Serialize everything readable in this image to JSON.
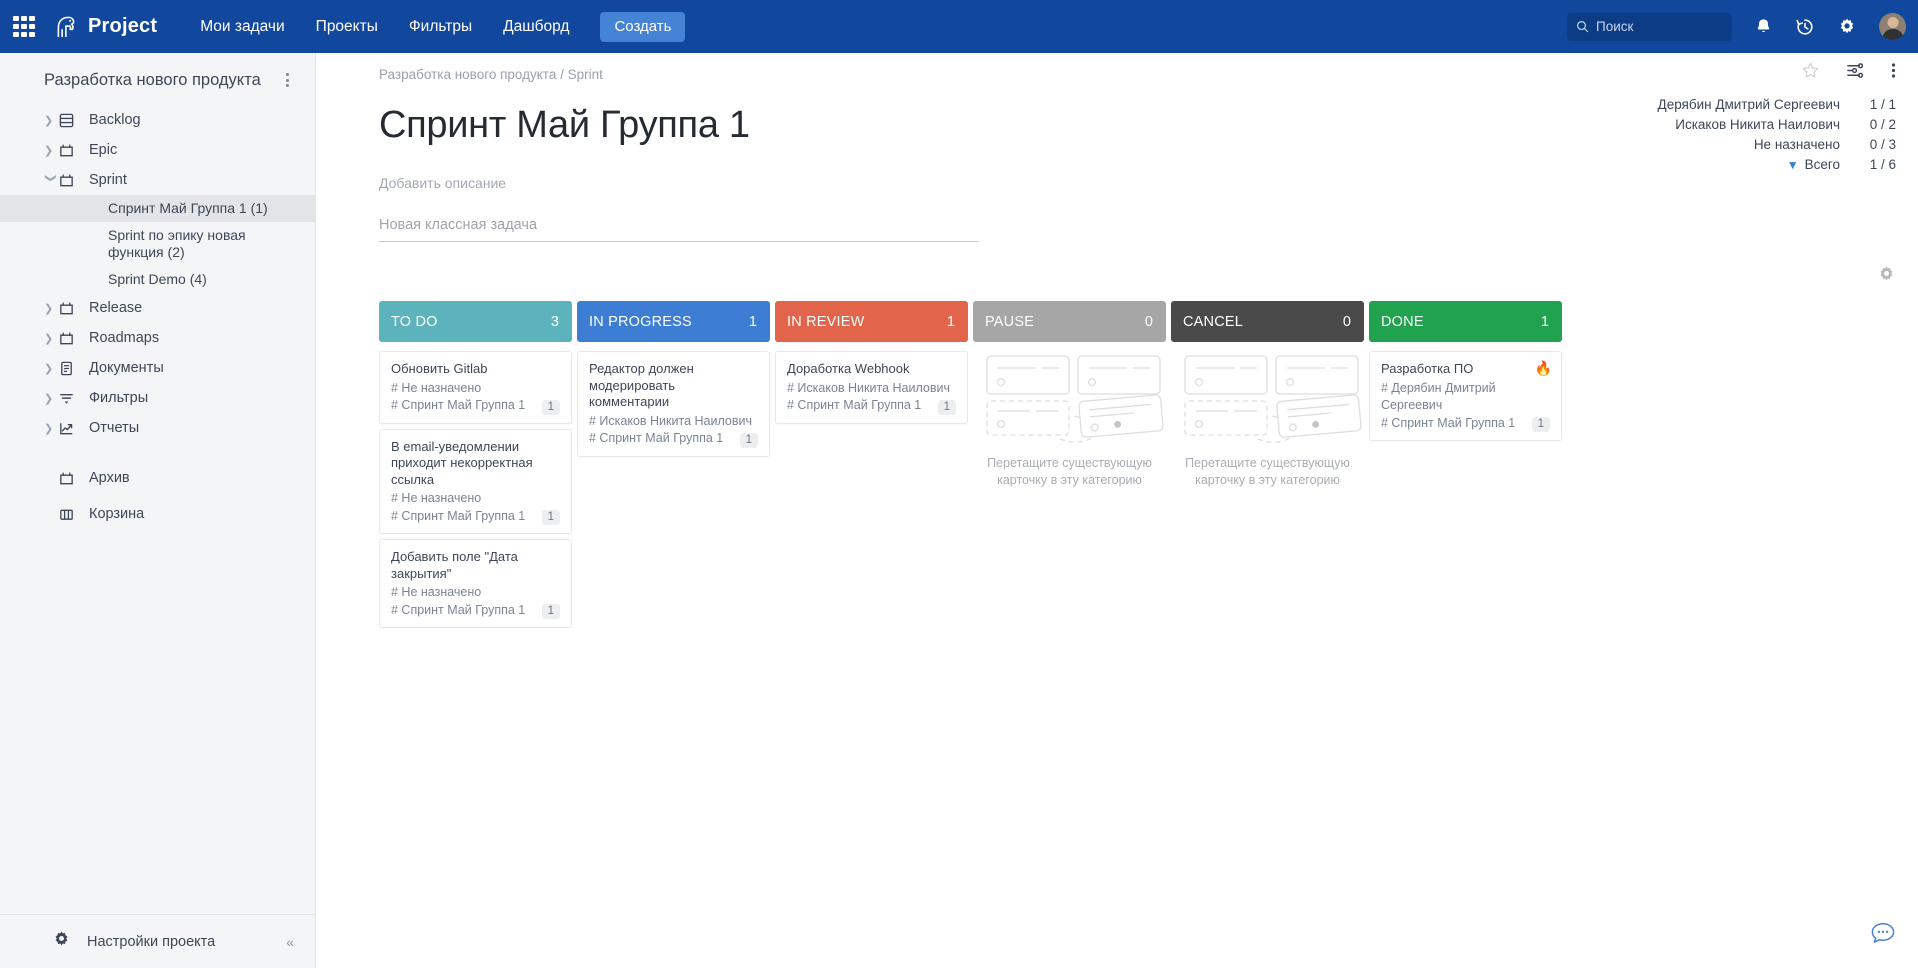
{
  "topbar": {
    "apps_icon": "grid-apps-icon",
    "brand": "Project",
    "nav": [
      {
        "label": "Мои задачи"
      },
      {
        "label": "Проекты"
      },
      {
        "label": "Фильтры"
      },
      {
        "label": "Дашборд"
      }
    ],
    "create_label": "Создать",
    "search_placeholder": "Поиск",
    "icons": [
      "notification-bell-icon",
      "history-clock-icon",
      "gear-icon",
      "avatar"
    ]
  },
  "sidebar": {
    "project_title": "Разработка нового продукта",
    "items": [
      {
        "label": "Backlog",
        "icon": "backlog-icon",
        "expanded": false
      },
      {
        "label": "Epic",
        "icon": "epic-icon",
        "expanded": false
      },
      {
        "label": "Sprint",
        "icon": "sprint-icon",
        "expanded": true
      }
    ],
    "sprint_children": [
      {
        "label": "Спринт Май Группа 1 (1)",
        "active": true
      },
      {
        "label": "Sprint по эпику новая функция (2)",
        "active": false
      },
      {
        "label": "Sprint Demo (4)",
        "active": false
      }
    ],
    "items2": [
      {
        "label": "Release",
        "icon": "release-icon"
      },
      {
        "label": "Roadmaps",
        "icon": "roadmap-icon"
      },
      {
        "label": "Документы",
        "icon": "document-icon"
      },
      {
        "label": "Фильтры",
        "icon": "filter-icon"
      },
      {
        "label": "Отчеты",
        "icon": "report-chart-icon"
      }
    ],
    "items3": [
      {
        "label": "Архив",
        "icon": "archive-icon"
      },
      {
        "label": "Корзина",
        "icon": "trash-columns-icon"
      }
    ],
    "footer_label": "Настройки проекта",
    "collapse_label": "«"
  },
  "main": {
    "breadcrumb": "Разработка нового продукта / Sprint",
    "page_title": "Спринт Май Группа 1",
    "description_placeholder": "Добавить описание",
    "newtask_placeholder": "Новая классная задача",
    "tools": [
      "star-icon",
      "sliders-icon",
      "more-vertical-icon"
    ],
    "board_gear": "board-settings-gear-icon"
  },
  "stats": {
    "rows": [
      {
        "name": "Дерябин Дмитрий Сергеевич",
        "value": "1 / 1"
      },
      {
        "name": "Искаков Никита Наилович",
        "value": "0 / 2"
      },
      {
        "name": "Не назначено",
        "value": "0 / 3"
      }
    ],
    "total_name": "Всего",
    "total_value": "1 / 6"
  },
  "board": {
    "empty_hint": "Перетащите существующую карточку в эту категорию",
    "columns": [
      {
        "title": "TO DO",
        "count": "3",
        "color": "#5cb3bb",
        "cards": [
          {
            "title": "Обновить Gitlab",
            "assignee": "# Не назначено",
            "sprint": "# Спринт Май Группа 1",
            "badge": "1",
            "flame": ""
          },
          {
            "title": "В email-уведомлении приходит некорректная ссылка",
            "assignee": "# Не назначено",
            "sprint": "# Спринт Май Группа 1",
            "badge": "1",
            "flame": ""
          },
          {
            "title": "Добавить поле \"Дата закрытия\"",
            "assignee": "# Не назначено",
            "sprint": "# Спринт Май Группа 1",
            "badge": "1",
            "flame": ""
          }
        ]
      },
      {
        "title": "IN PROGRESS",
        "count": "1",
        "color": "#3d7dd4",
        "cards": [
          {
            "title": "Редактор должен модерировать комментарии",
            "assignee": "# Искаков Никита Наилович",
            "sprint": "# Спринт Май Группа 1",
            "badge": "1",
            "flame": ""
          }
        ]
      },
      {
        "title": "IN REVIEW",
        "count": "1",
        "color": "#e2644a",
        "cards": [
          {
            "title": "Доработка Webhook",
            "assignee": "# Искаков Никита Наилович",
            "sprint": "# Спринт Май Группа 1",
            "badge": "1",
            "flame": ""
          }
        ]
      },
      {
        "title": "PAUSE",
        "count": "0",
        "color": "#a6a6a6",
        "cards": []
      },
      {
        "title": "CANCEL",
        "count": "0",
        "color": "#4a4a4a",
        "cards": []
      },
      {
        "title": "DONE",
        "count": "1",
        "color": "#21a24f",
        "cards": [
          {
            "title": "Разработка ПО",
            "assignee": "# Дерябин Дмитрий Сергеевич",
            "sprint": "# Спринт Май Группа 1",
            "badge": "1",
            "flame": "🔥"
          }
        ]
      }
    ]
  },
  "chat": {
    "icon": "chat-bubble-icon"
  }
}
